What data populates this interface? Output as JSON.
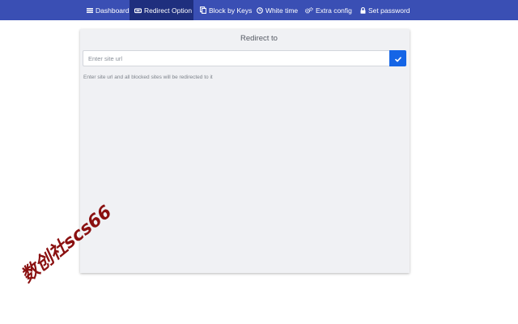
{
  "nav": {
    "items": [
      {
        "label": "Dashboard",
        "icon": "bars-icon",
        "active": false
      },
      {
        "label": "Redirect Option",
        "icon": "redirect-icon",
        "active": true
      },
      {
        "label": "Block by Keys",
        "icon": "copy-icon",
        "active": false
      },
      {
        "label": "White time",
        "icon": "clock-icon",
        "active": false
      },
      {
        "label": "Extra config",
        "icon": "gears-icon",
        "active": false
      },
      {
        "label": "Set password",
        "icon": "lock-icon",
        "active": false
      }
    ]
  },
  "panel": {
    "title": "Redirect to",
    "input_placeholder": "Enter site url",
    "input_value": "",
    "submit_icon": "check-icon",
    "help_text": "Enter site url and all blocked sites will be redirected to it"
  },
  "watermark": "数创社scs66",
  "colors": {
    "navbar": "#3a4fb4",
    "nav_active": "#1f2f7e",
    "panel_bg": "#f0f1f4",
    "submit_button": "#1565e6",
    "watermark": "#8a1010"
  }
}
